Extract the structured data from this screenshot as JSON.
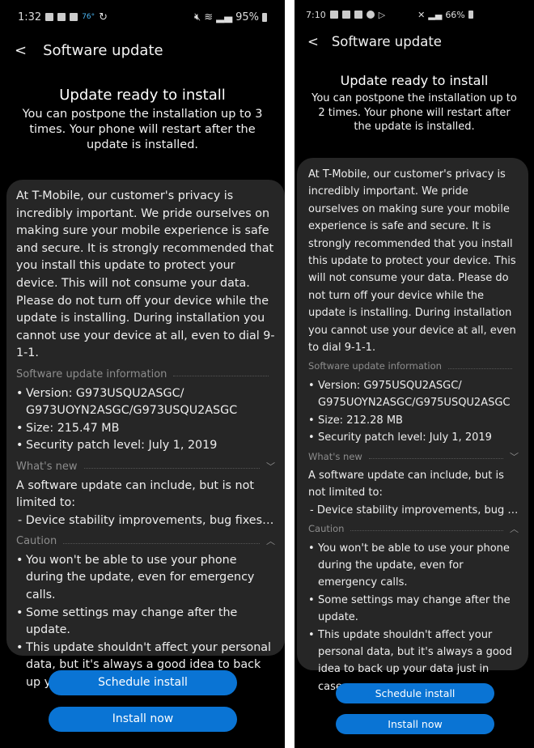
{
  "accent": "#0a74d4",
  "screens": [
    {
      "status": {
        "time": "1:32",
        "temp": "76°",
        "battery": "95%"
      },
      "header": {
        "title": "Software update"
      },
      "hero": {
        "title": "Update ready to install",
        "subtitle": "You can postpone the installation up to 3 times. Your phone will restart after the update is installed."
      },
      "card": {
        "intro": "At T-Mobile, our customer's privacy is incredibly important. We pride ourselves on making sure your mobile experience is safe and secure. It is strongly recommended that you install this update to protect your device. This will not consume your data. Please do not turn off your device while the update is installing. During installation you cannot use your device at all, even to dial 9-1-1.",
        "info_label": "Software update information",
        "info": [
          "Version: G973USQU2ASGC/ G973UOYN2ASGC/G973USQU2ASGC",
          "Size: 215.47 MB",
          "Security patch level: July 1, 2019"
        ],
        "whats_new_label": "What's new",
        "whats_new_text": "A software update can include, but is not limited to:",
        "whats_new_item": "- Device stability improvements, bug fixes....",
        "caution_label": "Caution",
        "caution": [
          "You won't be able to use your phone during the update, even for emergency calls.",
          "Some settings may change after the update.",
          "This update shouldn't affect your personal data, but it's always a good idea to back up your data just in case."
        ]
      },
      "buttons": {
        "schedule": "Schedule install",
        "install": "Install now"
      }
    },
    {
      "status": {
        "time": "7:10",
        "battery": "66%"
      },
      "header": {
        "title": "Software update"
      },
      "hero": {
        "title": "Update ready to install",
        "subtitle": "You can postpone the installation up to 2 times. Your phone will restart after the update is installed."
      },
      "card": {
        "intro": "At T-Mobile, our customer's privacy is incredibly important. We pride ourselves on making sure your mobile experience is safe and secure. It is strongly recommended that you install this update to protect your device. This will not consume your data. Please do not turn off your device while the update is installing. During installation you cannot use your device at all, even to dial 9-1-1.",
        "info_label": "Software update information",
        "info": [
          "Version: G975USQU2ASGC/ G975UOYN2ASGC/G975USQU2ASGC",
          "Size: 212.28 MB",
          "Security patch level: July 1, 2019"
        ],
        "whats_new_label": "What's new",
        "whats_new_text": "A software update can include, but is not limited to:",
        "whats_new_item": "- Device stability improvements, bug fi...",
        "caution_label": "Caution",
        "caution": [
          "You won't be able to use your phone during the update, even for emergency calls.",
          "Some settings may change after the update.",
          "This update shouldn't affect your personal data, but it's always a good idea to back up your data just in case."
        ]
      },
      "buttons": {
        "schedule": "Schedule install",
        "install": "Install now"
      }
    }
  ]
}
